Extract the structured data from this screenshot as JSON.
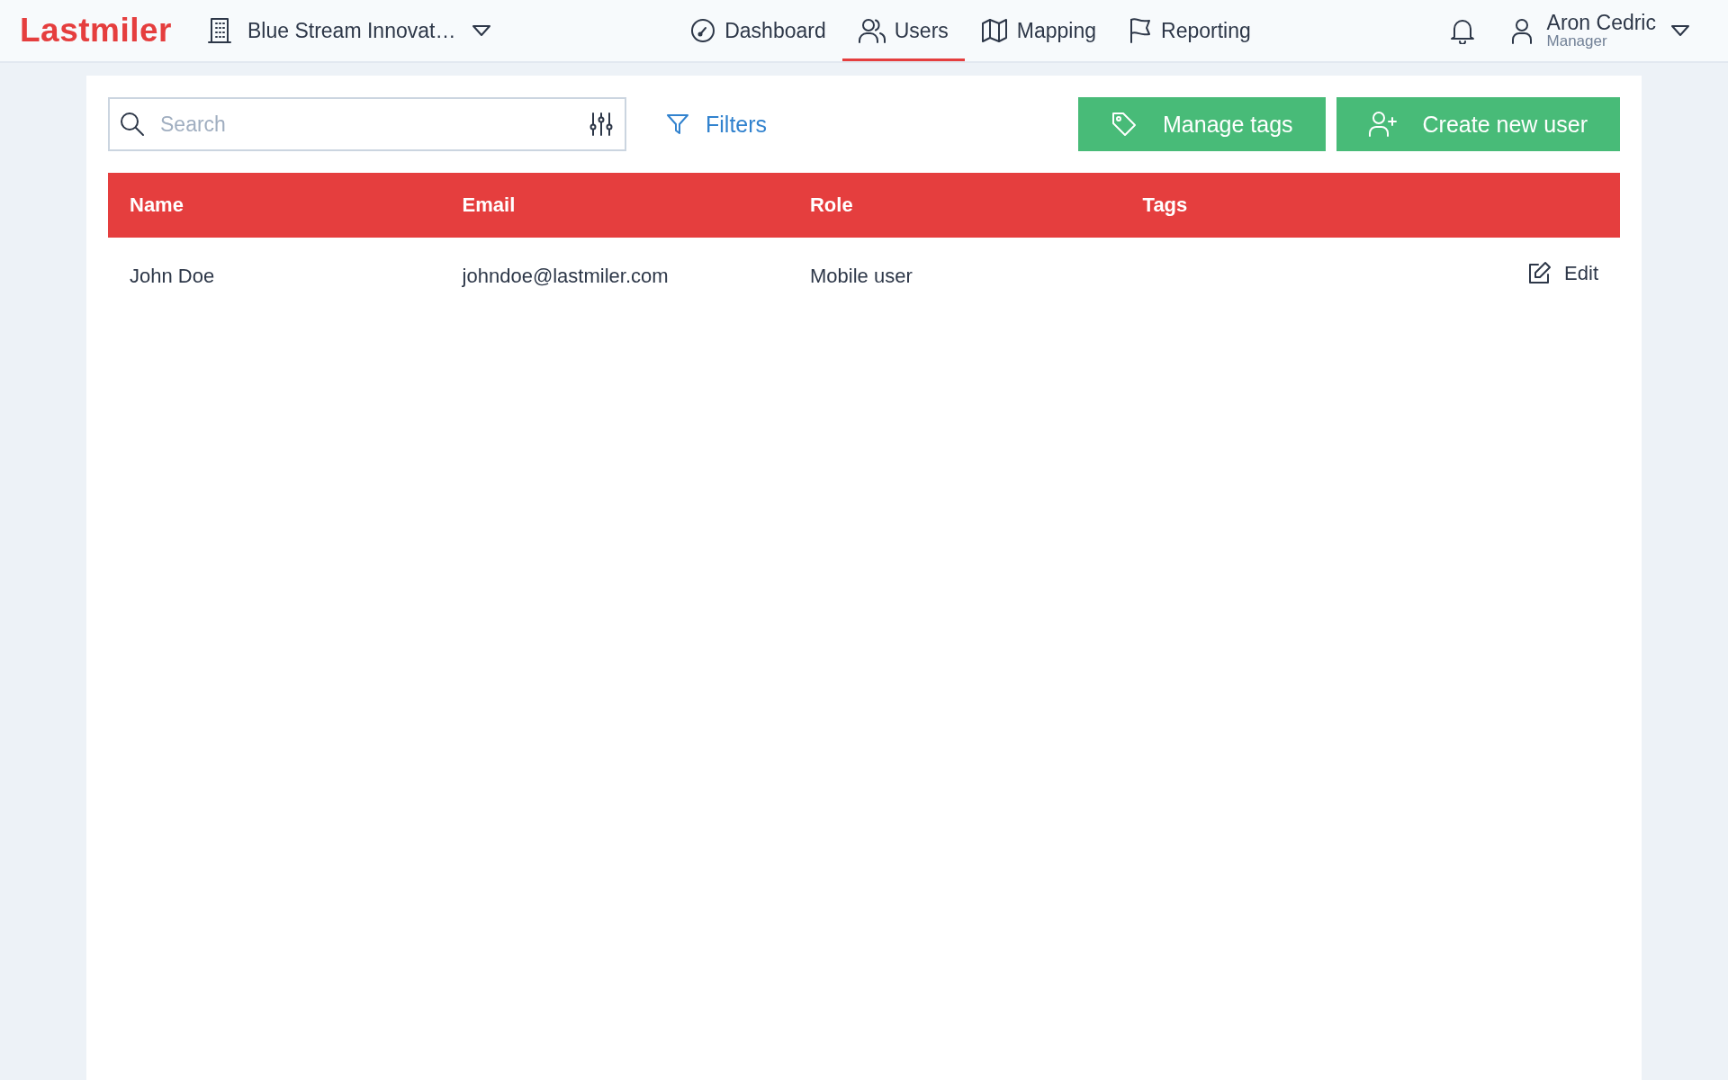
{
  "header": {
    "logo": "Lastmiler",
    "organization": "Blue Stream Innovat…",
    "nav": [
      {
        "label": "Dashboard",
        "selected": false
      },
      {
        "label": "Users",
        "selected": true
      },
      {
        "label": "Mapping",
        "selected": false
      },
      {
        "label": "Reporting",
        "selected": false
      }
    ],
    "user": {
      "name": "Aron Cedric",
      "role": "Manager"
    }
  },
  "toolbar": {
    "search": {
      "placeholder": "Search"
    },
    "filters": "Filters",
    "buttons": [
      "Manage tags",
      "Create new user"
    ]
  },
  "table": {
    "columns": [
      "Name",
      "Email",
      "Role",
      "Tags"
    ],
    "rows": [
      {
        "name": "John Doe",
        "email": "johndoe@lastmiler.com",
        "role": "Mobile user",
        "action": "Edit"
      }
    ]
  }
}
